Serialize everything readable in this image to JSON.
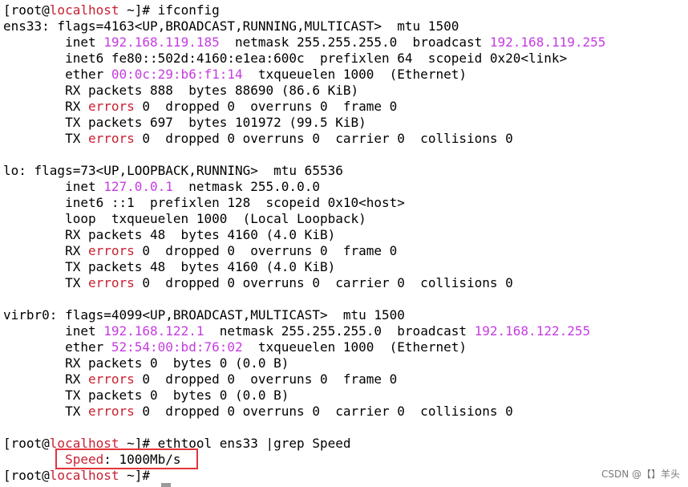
{
  "terminal": {
    "palette": {
      "default": "#000000",
      "red": "#c81f32",
      "magenta": "#c53ce0",
      "box": "#e3343a"
    },
    "lines": [
      [
        {
          "t": "[root@"
        },
        {
          "t": "localhost",
          "c": "red"
        },
        {
          "t": " ~]# ifconfig"
        }
      ],
      [
        {
          "t": "ens33: flags=4163<UP,BROADCAST,RUNNING,MULTICAST>  mtu 1500"
        }
      ],
      [
        {
          "t": "        inet "
        },
        {
          "t": "192.168.119.185",
          "c": "mag"
        },
        {
          "t": "  netmask 255.255.255.0  broadcast "
        },
        {
          "t": "192.168.119.255",
          "c": "mag"
        }
      ],
      [
        {
          "t": "        inet6 fe80::502d:4160:e1ea:600c  prefixlen 64  scopeid 0x20<link>"
        }
      ],
      [
        {
          "t": "        ether "
        },
        {
          "t": "00:0c:29:b6:f1:14",
          "c": "mag"
        },
        {
          "t": "  txqueuelen 1000  (Ethernet)"
        }
      ],
      [
        {
          "t": "        RX packets 888  bytes 88690 (86.6 KiB)"
        }
      ],
      [
        {
          "t": "        RX "
        },
        {
          "t": "errors",
          "c": "red"
        },
        {
          "t": " 0  dropped 0  overruns 0  frame 0"
        }
      ],
      [
        {
          "t": "        TX packets 697  bytes 101972 (99.5 KiB)"
        }
      ],
      [
        {
          "t": "        TX "
        },
        {
          "t": "errors",
          "c": "red"
        },
        {
          "t": " 0  dropped 0 overruns 0  carrier 0  collisions 0"
        }
      ],
      [
        {
          "t": ""
        }
      ],
      [
        {
          "t": "lo: flags=73<UP,LOOPBACK,RUNNING>  mtu 65536"
        }
      ],
      [
        {
          "t": "        inet "
        },
        {
          "t": "127.0.0.1",
          "c": "mag"
        },
        {
          "t": "  netmask 255.0.0.0"
        }
      ],
      [
        {
          "t": "        inet6 ::1  prefixlen 128  scopeid 0x10<host>"
        }
      ],
      [
        {
          "t": "        loop  txqueuelen 1000  (Local Loopback)"
        }
      ],
      [
        {
          "t": "        RX packets 48  bytes 4160 (4.0 KiB)"
        }
      ],
      [
        {
          "t": "        RX "
        },
        {
          "t": "errors",
          "c": "red"
        },
        {
          "t": " 0  dropped 0  overruns 0  frame 0"
        }
      ],
      [
        {
          "t": "        TX packets 48  bytes 4160 (4.0 KiB)"
        }
      ],
      [
        {
          "t": "        TX "
        },
        {
          "t": "errors",
          "c": "red"
        },
        {
          "t": " 0  dropped 0 overruns 0  carrier 0  collisions 0"
        }
      ],
      [
        {
          "t": ""
        }
      ],
      [
        {
          "t": "virbr0: flags=4099<UP,BROADCAST,MULTICAST>  mtu 1500"
        }
      ],
      [
        {
          "t": "        inet "
        },
        {
          "t": "192.168.122.1",
          "c": "mag"
        },
        {
          "t": "  netmask 255.255.255.0  broadcast "
        },
        {
          "t": "192.168.122.255",
          "c": "mag"
        }
      ],
      [
        {
          "t": "        ether "
        },
        {
          "t": "52:54:00:bd:76:02",
          "c": "mag"
        },
        {
          "t": "  txqueuelen 1000  (Ethernet)"
        }
      ],
      [
        {
          "t": "        RX packets 0  bytes 0 (0.0 B)"
        }
      ],
      [
        {
          "t": "        RX "
        },
        {
          "t": "errors",
          "c": "red"
        },
        {
          "t": " 0  dropped 0  overruns 0  frame 0"
        }
      ],
      [
        {
          "t": "        TX packets 0  bytes 0 (0.0 B)"
        }
      ],
      [
        {
          "t": "        TX "
        },
        {
          "t": "errors",
          "c": "red"
        },
        {
          "t": " 0  dropped 0 overruns 0  carrier 0  collisions 0"
        }
      ],
      [
        {
          "t": ""
        }
      ],
      [
        {
          "t": "[root@"
        },
        {
          "t": "localhost",
          "c": "red"
        },
        {
          "t": " ~]# ethtool ens33 |grep Speed"
        }
      ],
      [
        {
          "t": "        "
        },
        {
          "t": "Speed",
          "c": "red"
        },
        {
          "t": ": 1000Mb/s"
        }
      ],
      [
        {
          "t": "[root@"
        },
        {
          "t": "localhost",
          "c": "red"
        },
        {
          "t": " ~]#"
        }
      ]
    ]
  },
  "watermark": {
    "text": "CSDN @【】羊头"
  }
}
